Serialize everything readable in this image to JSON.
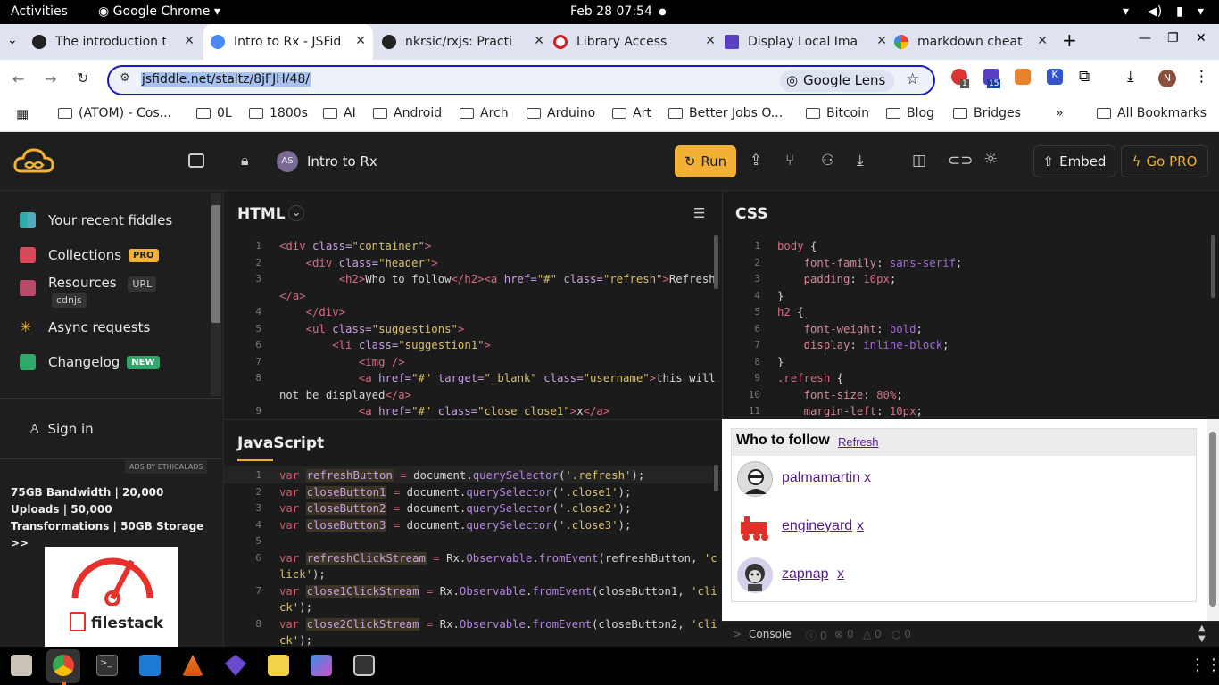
{
  "topbar": {
    "activities": "Activities",
    "app": "Google Chrome",
    "clock": "Feb 28  07:54"
  },
  "tabs": [
    {
      "title": "The introduction t",
      "color": "#222"
    },
    {
      "title": "Intro to Rx - JSFid",
      "color": "#4a8af4"
    },
    {
      "title": "nkrsic/rxjs: Practi",
      "color": "#222"
    },
    {
      "title": "Library Access",
      "color": "#c22"
    },
    {
      "title": "Display Local Imag",
      "color": "#5a3fc0"
    },
    {
      "title": "markdown cheat",
      "color": "#4285f4"
    }
  ],
  "omnibox": {
    "url": "jsfiddle.net/staltz/8jFJH/48/",
    "lens": "Google Lens"
  },
  "extensions": {
    "badge1": "1",
    "badge2": "15",
    "profile": "N"
  },
  "bookmarks": [
    "(ATOM) - Cos...",
    "0L",
    "1800s",
    "AI",
    "Android",
    "Arch",
    "Arduino",
    "Art",
    "Better Jobs O...",
    "Bitcoin",
    "Blog",
    "Bridges"
  ],
  "all_bookmarks": "All Bookmarks",
  "jsfiddle": {
    "avatar": "AS",
    "fiddle_title": "Intro to Rx",
    "run": "Run",
    "embed": "Embed",
    "gopro": "Go PRO",
    "sidebar": {
      "recent": "Your recent fiddles",
      "collections": "Collections",
      "pro_badge": "PRO",
      "resources": "Resources",
      "url_badge": "URL",
      "cdnjs": "cdnjs",
      "async": "Async requests",
      "changelog": "Changelog",
      "new_badge": "NEW",
      "signin": "Sign in",
      "ads_label": "ADS BY ETHICALADS",
      "ad_text": "75GB Bandwidth | 20,000 Uploads | 50,000 Transformations | 50GB Storage >>",
      "ad_brand": "filestack"
    },
    "html_title": "HTML",
    "css_title": "CSS",
    "js_title": "JavaScript",
    "console": {
      "label": "Console",
      "c1": "0",
      "c2": "0",
      "c3": "0",
      "c4": "0"
    }
  },
  "result": {
    "heading": "Who to follow",
    "refresh": "Refresh",
    "users": [
      {
        "name": "palmamartin",
        "close": "x"
      },
      {
        "name": "engineyard",
        "close": "x"
      },
      {
        "name": "zapnap",
        "close": "x"
      }
    ]
  }
}
